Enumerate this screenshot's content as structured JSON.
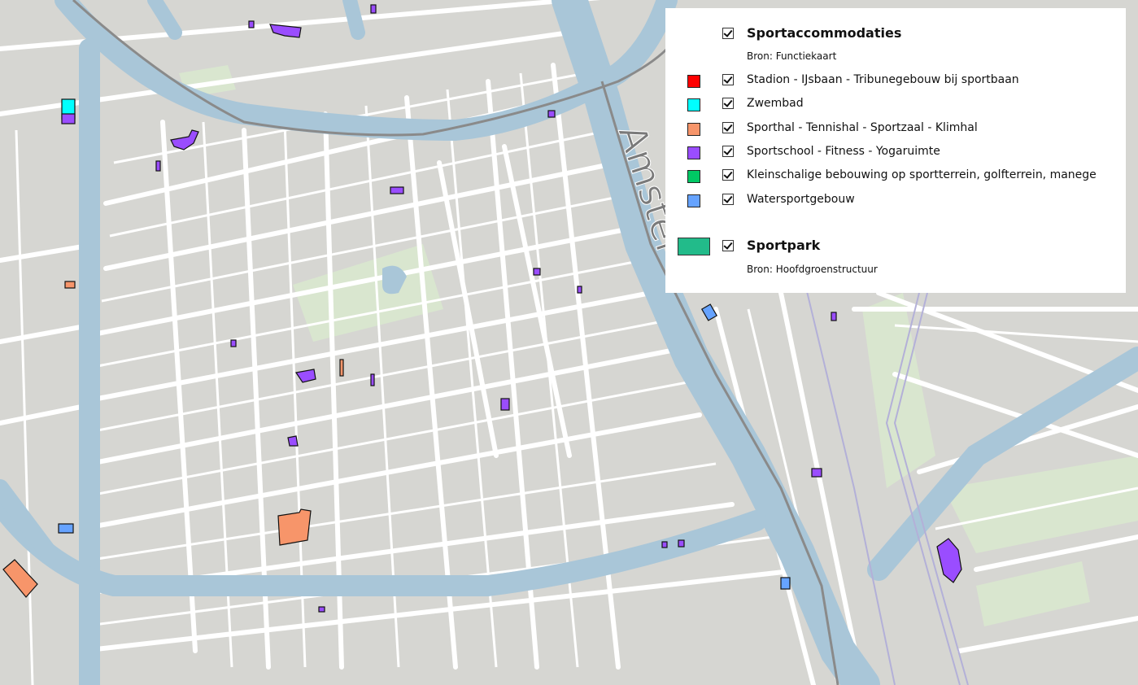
{
  "map": {
    "water_label": "Amstel",
    "colors": {
      "land": "#d6d6d2",
      "street": "#ffffff",
      "water": "#a9c6d8",
      "green": "#d9e6cf",
      "railway": "#8a8a8a",
      "tram": "#b3b0d8"
    }
  },
  "legend": {
    "groups": [
      {
        "title": "Sportaccommodaties",
        "source": "Bron: Functiekaart",
        "checked": true,
        "items": [
          {
            "label": "Stadion - IJsbaan - Tribunegebouw bij sportbaan",
            "color": "#ff0000",
            "checked": true
          },
          {
            "label": "Zwembad",
            "color": "#00ffff",
            "checked": true
          },
          {
            "label": "Sporthal - Tennishal - Sportzaal - Klimhal",
            "color": "#f7956a",
            "checked": true
          },
          {
            "label": "Sportschool - Fitness - Yogaruimte",
            "color": "#9a4dff",
            "checked": true
          },
          {
            "label": "Kleinschalige bebouwing op sportterrein, golfterrein, manege",
            "color": "#00c864",
            "checked": true
          },
          {
            "label": "Watersportgebouw",
            "color": "#66a3ff",
            "checked": true
          }
        ]
      },
      {
        "title": "Sportpark",
        "source": "Bron: Hoofdgroenstructuur",
        "checked": true,
        "color": "#22bb8a"
      }
    ]
  }
}
